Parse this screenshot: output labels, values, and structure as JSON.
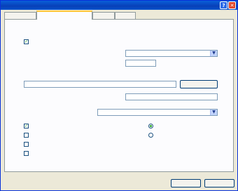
{
  "window": {
    "title": ""
  },
  "tabs": [
    {
      "label": ""
    },
    {
      "label": ""
    },
    {
      "label": ""
    },
    {
      "label": ""
    }
  ],
  "panel": {
    "enable_compression": {
      "label": "",
      "checked": true
    },
    "row1": {
      "label": "",
      "value": ""
    },
    "row2": {
      "label": "",
      "value": ""
    },
    "path_label": "",
    "path_value": "",
    "browse_label": "",
    "row3": {
      "label": "",
      "value": ""
    },
    "row4": {
      "label": "",
      "value": ""
    },
    "options": [
      {
        "label": "",
        "checked": true
      },
      {
        "label": "",
        "checked": false
      },
      {
        "label": "",
        "checked": false
      },
      {
        "label": "",
        "checked": false
      }
    ],
    "radios": [
      {
        "label": "",
        "selected": true
      },
      {
        "label": "",
        "selected": false
      }
    ]
  },
  "footer": {
    "ok_label": "",
    "cancel_label": ""
  },
  "colors": {
    "title_bar": "#0840b8",
    "dialog_bg": "#ece9d8",
    "panel_bg": "#fcfcfe",
    "check_mark": "#21a121"
  }
}
